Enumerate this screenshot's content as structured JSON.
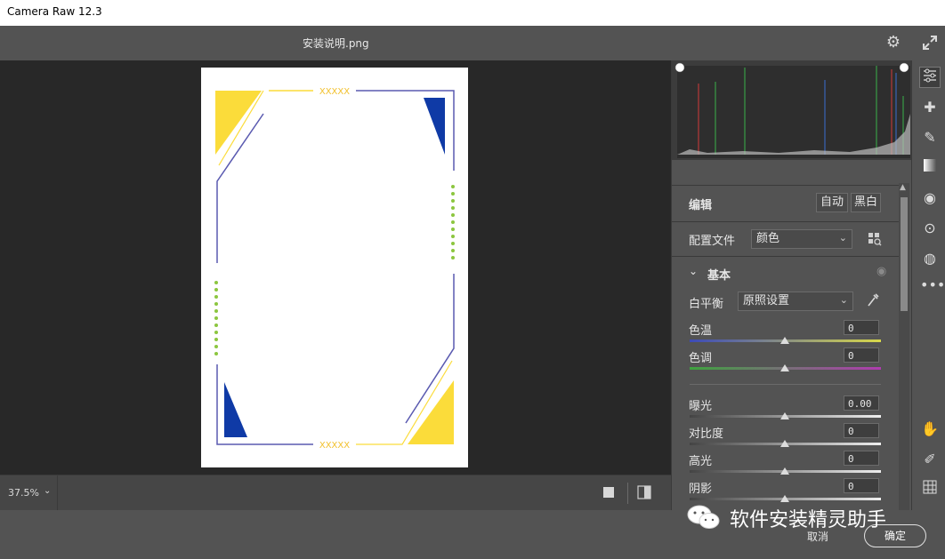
{
  "app": {
    "title": "Camera Raw 12.3"
  },
  "document": {
    "filename": "安装说明.png"
  },
  "photo": {
    "top_text": "XXXXX",
    "bottom_text": "XXXXX"
  },
  "zoom": {
    "label": "37.5%"
  },
  "edit": {
    "title": "编辑",
    "auto_label": "自动",
    "bw_label": "黑白",
    "profile_label": "配置文件",
    "profile_value": "颜色"
  },
  "basic": {
    "title": "基本",
    "wb_label": "白平衡",
    "wb_value": "原照设置",
    "sliders": [
      {
        "label": "色温",
        "value": "0"
      },
      {
        "label": "色调",
        "value": "0"
      },
      {
        "label": "曝光",
        "value": "0.00"
      },
      {
        "label": "对比度",
        "value": "0"
      },
      {
        "label": "高光",
        "value": "0"
      },
      {
        "label": "阴影",
        "value": "0"
      }
    ]
  },
  "footer": {
    "cancel_label": "取消",
    "ok_label": "确定"
  },
  "watermark": {
    "text": "软件安装精灵助手"
  },
  "colors": {
    "accent_blue": "#0f3aa6",
    "accent_yellow": "#fbdc3a",
    "dot_green": "#8cc63f"
  }
}
